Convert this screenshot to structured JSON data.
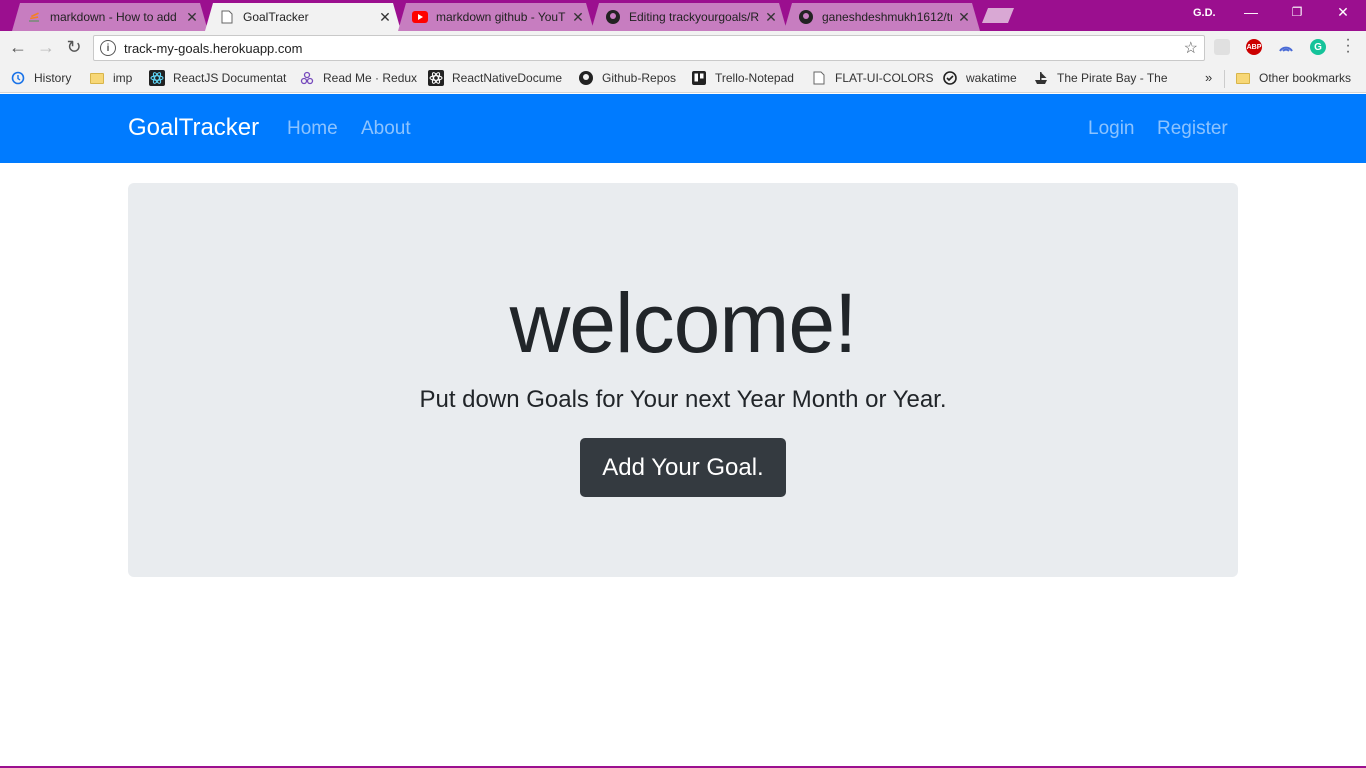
{
  "browser": {
    "tabs": [
      {
        "title": "markdown - How to add",
        "icon": "stackoverflow-icon",
        "active": false
      },
      {
        "title": "GoalTracker",
        "icon": "page-icon",
        "active": true
      },
      {
        "title": "markdown github - YouT",
        "icon": "youtube-icon",
        "active": false
      },
      {
        "title": "Editing trackyourgoals/R",
        "icon": "github-icon",
        "active": false
      },
      {
        "title": "ganeshdeshmukh1612/tr",
        "icon": "github-icon",
        "active": false
      }
    ],
    "user": "G.D.",
    "address": "track-my-goals.herokuapp.com",
    "bookmarks": [
      {
        "label": "History",
        "icon": "history-icon"
      },
      {
        "label": "imp",
        "icon": "folder-icon"
      },
      {
        "label": "ReactJS Documentat",
        "icon": "react-icon"
      },
      {
        "label": "Read Me · Redux",
        "icon": "redux-icon"
      },
      {
        "label": "ReactNativeDocume",
        "icon": "react-icon"
      },
      {
        "label": "Github-Repos",
        "icon": "github-icon"
      },
      {
        "label": "Trello-Notepad",
        "icon": "trello-icon"
      },
      {
        "label": "FLAT-UI-COLORS",
        "icon": "page-icon"
      },
      {
        "label": "wakatime",
        "icon": "wakatime-icon"
      },
      {
        "label": "The Pirate Bay - The",
        "icon": "pirate-icon"
      }
    ],
    "bookmarks_overflow": "»",
    "other_bookmarks": "Other bookmarks"
  },
  "site": {
    "brand": "GoalTracker",
    "nav_left": [
      "Home",
      "About"
    ],
    "nav_right": [
      "Login",
      "Register"
    ],
    "hero": {
      "title": "welcome!",
      "lead": "Put down Goals for Your next Year Month or Year.",
      "button": "Add Your Goal."
    }
  },
  "colors": {
    "chrome_frame": "#9b0f8f",
    "navbar": "#007bff",
    "jumbotron": "#e9ecef",
    "button": "#343a40"
  }
}
